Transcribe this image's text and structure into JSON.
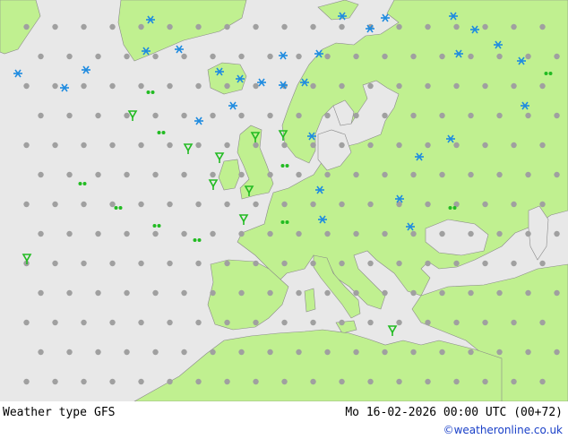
{
  "map": {
    "colors": {
      "sea": "#e8e8e8",
      "land": "#c0f090",
      "border": "#9a9a9a",
      "coast": "#8a8a8a"
    },
    "legend_symbols": {
      "dry": {
        "color": "#a0a0a0",
        "icon": "dot-icon"
      },
      "rain": {
        "color": "#22bb22",
        "icon": "rain-shower-icon"
      },
      "snow": {
        "color": "#1e8be0",
        "icon": "snow-shower-icon"
      },
      "drizzle": {
        "color": "#22bb22",
        "icon": "drizzle-icon"
      }
    }
  },
  "footer": {
    "product": "Weather type",
    "model": "GFS",
    "valid_time": "Mo 16-02-2026 00:00 UTC (00+72)",
    "credit": "©weatheronline.co.uk"
  }
}
